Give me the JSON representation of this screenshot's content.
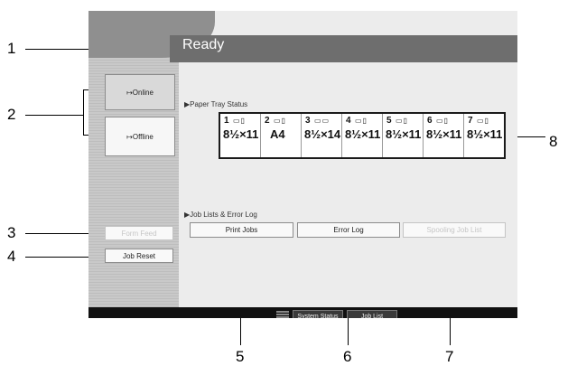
{
  "header": {
    "status": "Ready"
  },
  "sidebar": {
    "online_label": "↦Online",
    "offline_label": "↦Offline",
    "form_feed_label": "Form Feed",
    "job_reset_label": "Job Reset"
  },
  "paper_tray": {
    "section_label": "▶Paper Tray Status",
    "trays": [
      {
        "num": "1",
        "size": "8½×11"
      },
      {
        "num": "2",
        "size": "A4"
      },
      {
        "num": "3",
        "size": "8½×14"
      },
      {
        "num": "4",
        "size": "8½×11"
      },
      {
        "num": "5",
        "size": "8½×11"
      },
      {
        "num": "6",
        "size": "8½×11"
      },
      {
        "num": "7",
        "size": "8½×11"
      }
    ]
  },
  "jobs": {
    "section_label": "▶Job Lists & Error Log",
    "print_jobs_label": "Print Jobs",
    "error_log_label": "Error Log",
    "spooling_label": "Spooling Job List"
  },
  "footer": {
    "system_status_label": "System Status",
    "job_list_label": "Job List"
  },
  "callouts": [
    "1",
    "2",
    "3",
    "4",
    "5",
    "6",
    "7",
    "8"
  ],
  "colors": {
    "status_bar": "#6e6e6e",
    "panel": "#ececec",
    "bottom_bar": "#111111"
  }
}
